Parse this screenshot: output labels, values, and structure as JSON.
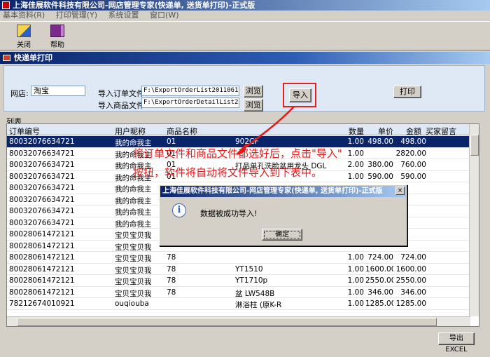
{
  "window": {
    "title": "上海佳展软件科技有限公司-网店管理专家(快递单, 送货单打印)-正式版"
  },
  "menu": [
    "基本资料(R)",
    "打印管理(Y)",
    "系统设置",
    "窗口(W)"
  ],
  "toolbar": {
    "close_label": "关闭",
    "help_label": "帮助"
  },
  "subwindow": {
    "title": "快递单打印"
  },
  "form": {
    "shop_label": "网店:",
    "shop_value": "淘宝",
    "order_file_label": "导入订单文件:",
    "order_file_value": "F:\\ExportOrderList2011061016(",
    "goods_file_label": "导入商品文件:",
    "goods_file_value": "F:\\ExportOrderDetailList2011(",
    "browse_label": "浏览",
    "import_label": "导入",
    "print_label": "打印"
  },
  "grid": {
    "section_label": "列表",
    "columns": [
      "订单编号",
      "用户昵称",
      "商品名称",
      "数量",
      "单价",
      "金额",
      "买家留言"
    ],
    "rows": [
      [
        "80032076634721",
        "我的命我主",
        "01",
        "902CF",
        "1.00",
        "498.00",
        "498.00"
      ],
      [
        "80032076634721",
        "我的命我主",
        "01",
        "",
        "1.00",
        "",
        "2820.00"
      ],
      [
        "80032076634721",
        "我的命我主",
        "01",
        "打品单孔洗脸盆用龙头 DGL",
        "2.00",
        "380.00",
        "760.00"
      ],
      [
        "80032076634721",
        "我的命我主",
        "01",
        "",
        "1.00",
        "590.00",
        "590.00"
      ],
      [
        "80032076634721",
        "我的命我主",
        "",
        "",
        "",
        "",
        ""
      ],
      [
        "80032076634721",
        "我的命我主",
        "",
        "",
        "",
        "",
        ""
      ],
      [
        "80032076634721",
        "我的命我主",
        "",
        "",
        "",
        "",
        ""
      ],
      [
        "80032076634721",
        "我的命我主",
        "",
        "",
        "",
        "",
        ""
      ],
      [
        "80028061472121",
        "宝贝宝贝我",
        "",
        "",
        "",
        "",
        ""
      ],
      [
        "80028061472121",
        "宝贝宝贝我",
        "",
        "",
        "",
        "",
        ""
      ],
      [
        "80028061472121",
        "宝贝宝贝我",
        "78",
        "",
        "1.00",
        "724.00",
        "724.00"
      ],
      [
        "80028061472121",
        "宝贝宝贝我",
        "78",
        "YT1510",
        "1.00",
        "1600.00",
        "1600.00"
      ],
      [
        "80028061472121",
        "宝贝宝贝我",
        "78",
        "YT1710p",
        "1.00",
        "2550.00",
        "2550.00"
      ],
      [
        "80028061472121",
        "宝贝宝贝我",
        "78",
        "盆 LW548B",
        "1.00",
        "346.00",
        "346.00"
      ],
      [
        "78212674010921",
        "ouqiouba",
        "",
        "淋浴柱 (原K-R",
        "1.00",
        "1285.00",
        "1285.00"
      ]
    ],
    "export_label": "导出EXCEL"
  },
  "dialog": {
    "title": "上海佳展软件科技有限公司-网店管理专家(快递单, 送货单打印)-正式版",
    "message": "数据被成功导入!",
    "ok_label": "确定",
    "close_glyph": "×",
    "icon_glyph": "i"
  },
  "annotation": {
    "line1": "将订单文件和商品文件都选好后，点击\"导入\"",
    "line2": "按扭，软件将自动将文件导入到下表中。"
  },
  "colors": {
    "accent": "#e41a1a",
    "titlebar": "#0a246a",
    "selection": "#0a246a"
  }
}
